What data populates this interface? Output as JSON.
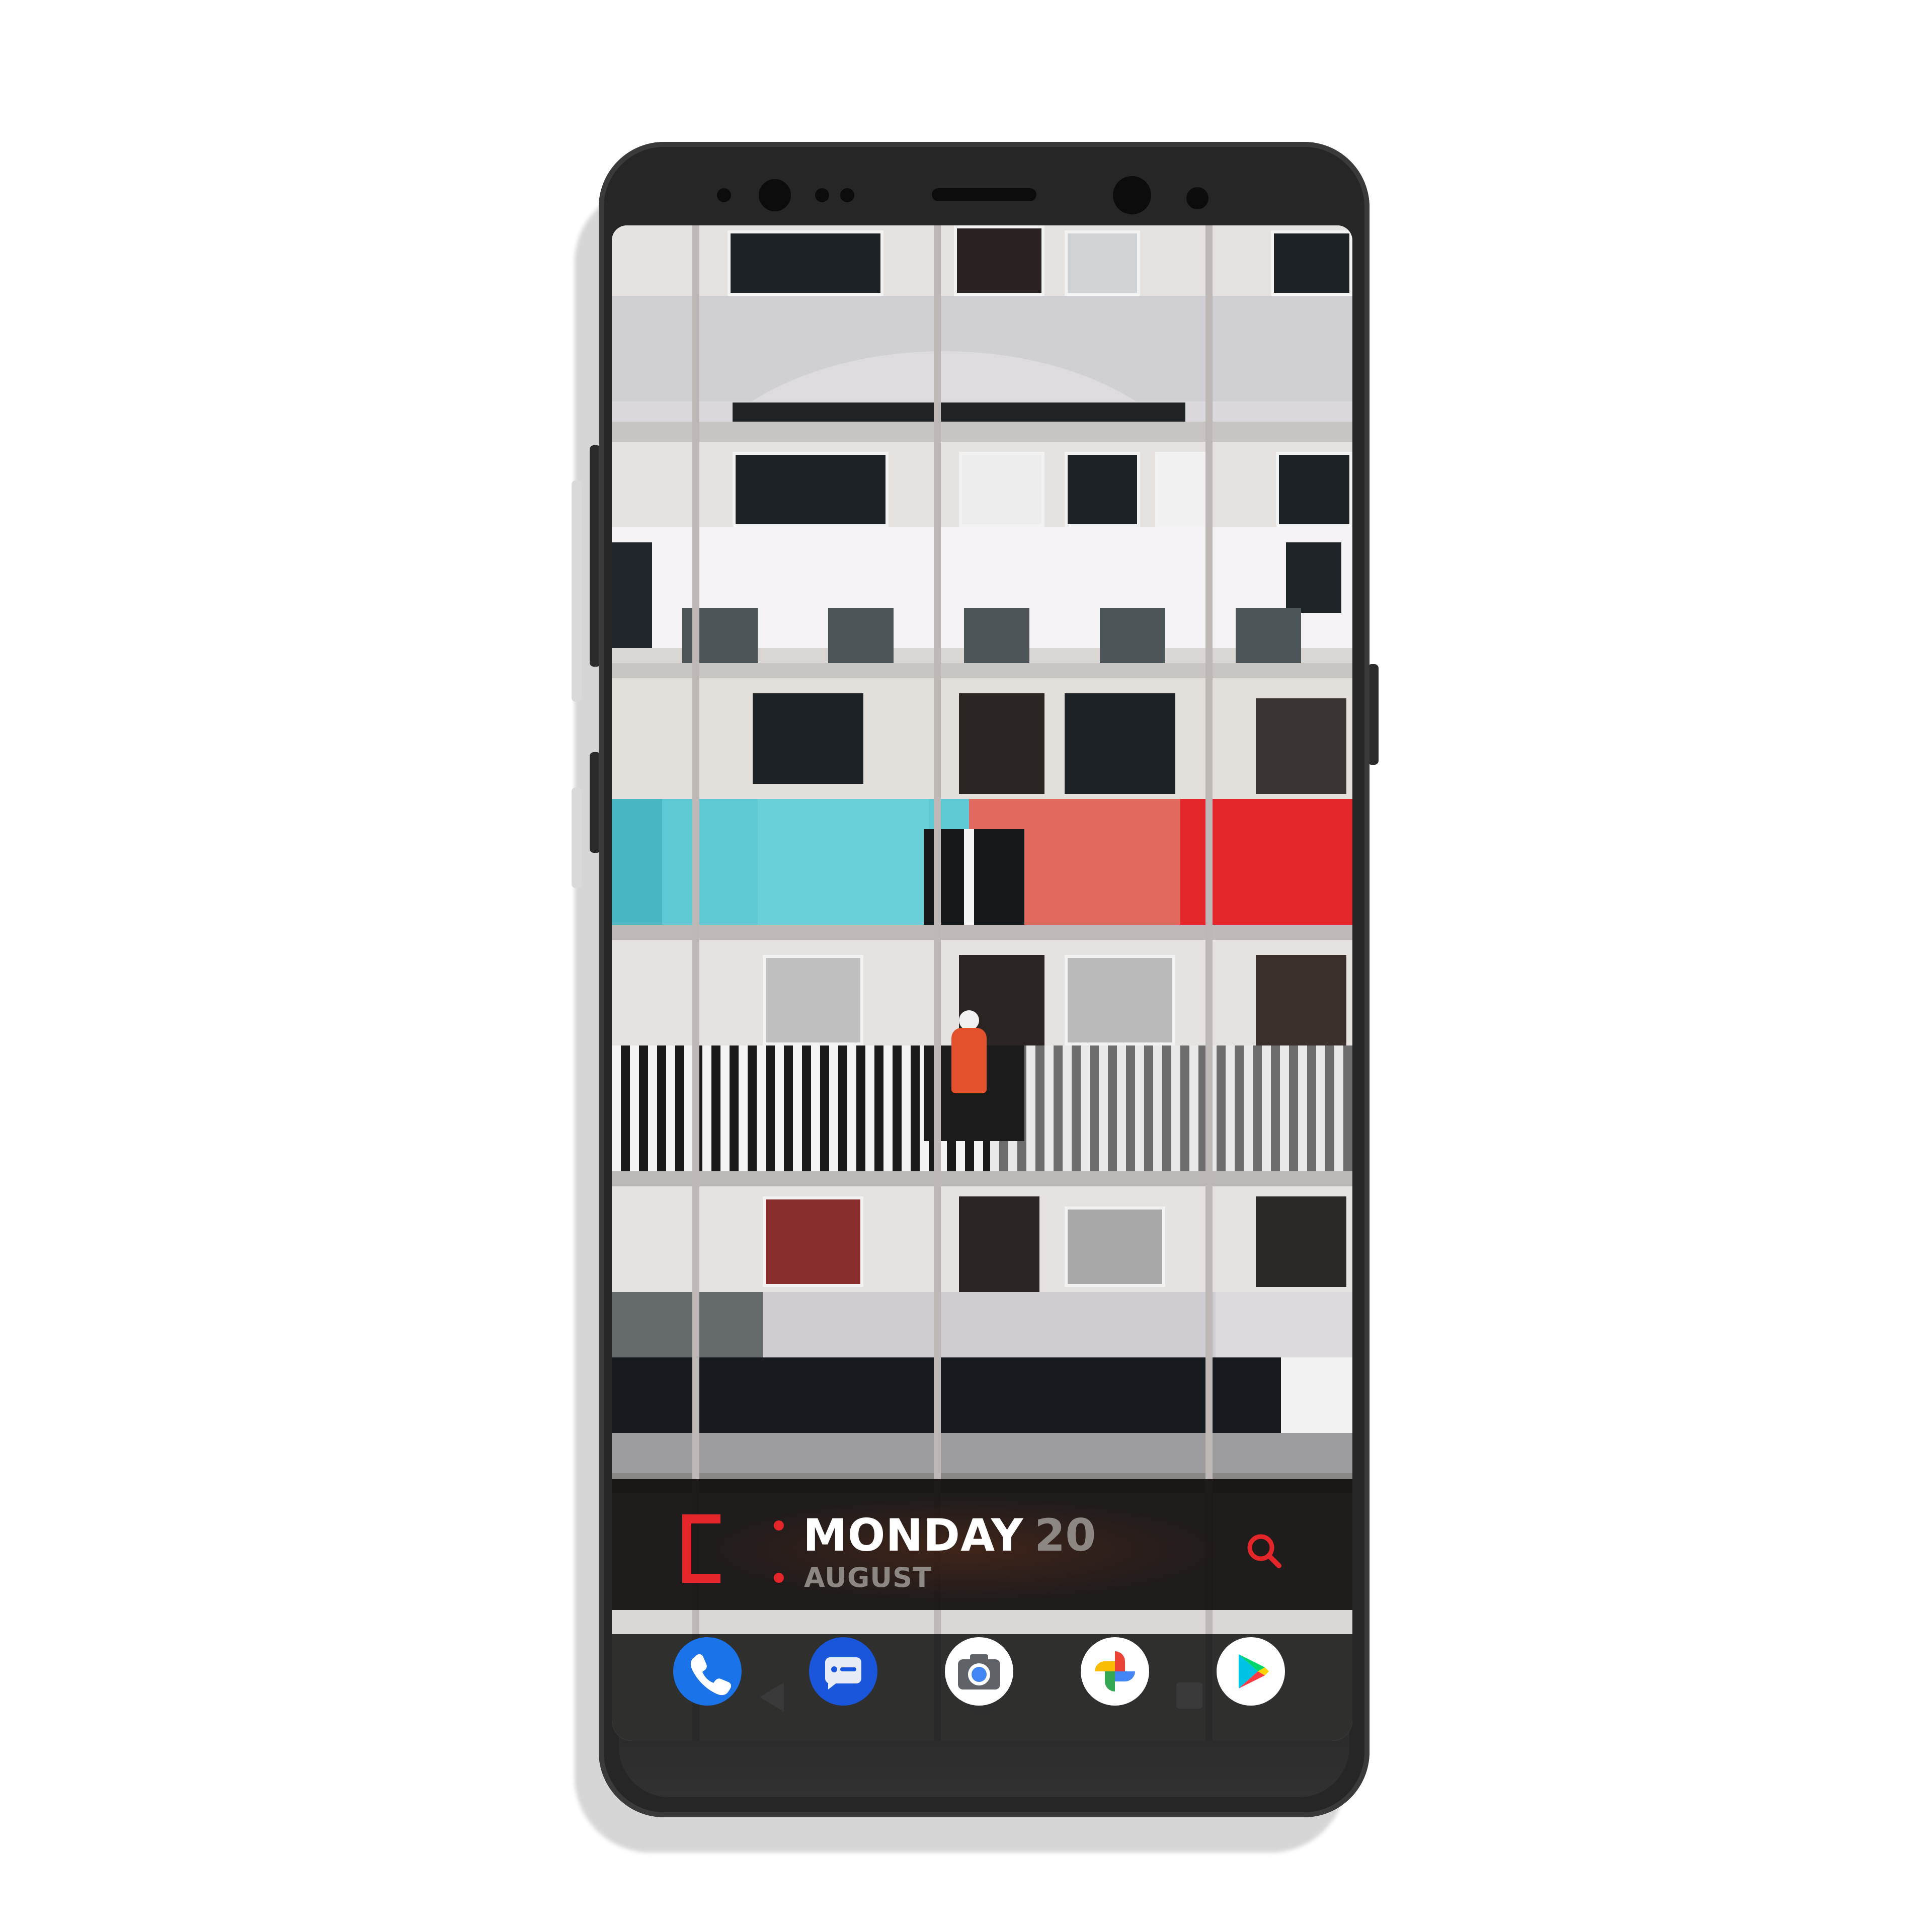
{
  "widget": {
    "day": "MONDAY",
    "date": "20",
    "month": "AUGUST",
    "accent_color": "#e4262a",
    "search_icon": "search-icon"
  },
  "dock": {
    "apps": [
      {
        "name": "Phone",
        "icon": "phone-icon",
        "color": "#1a73e8"
      },
      {
        "name": "Messages",
        "icon": "messages-icon",
        "color": "#1a56db"
      },
      {
        "name": "Camera",
        "icon": "camera-icon",
        "color": "#ffffff"
      },
      {
        "name": "Photos",
        "icon": "pinwheel-icon",
        "color": "#ffffff"
      },
      {
        "name": "Play Store",
        "icon": "play-store-icon",
        "color": "#ffffff"
      }
    ]
  },
  "navigation": {
    "back": "back-icon",
    "home": "home-icon",
    "recents": "recents-icon"
  }
}
